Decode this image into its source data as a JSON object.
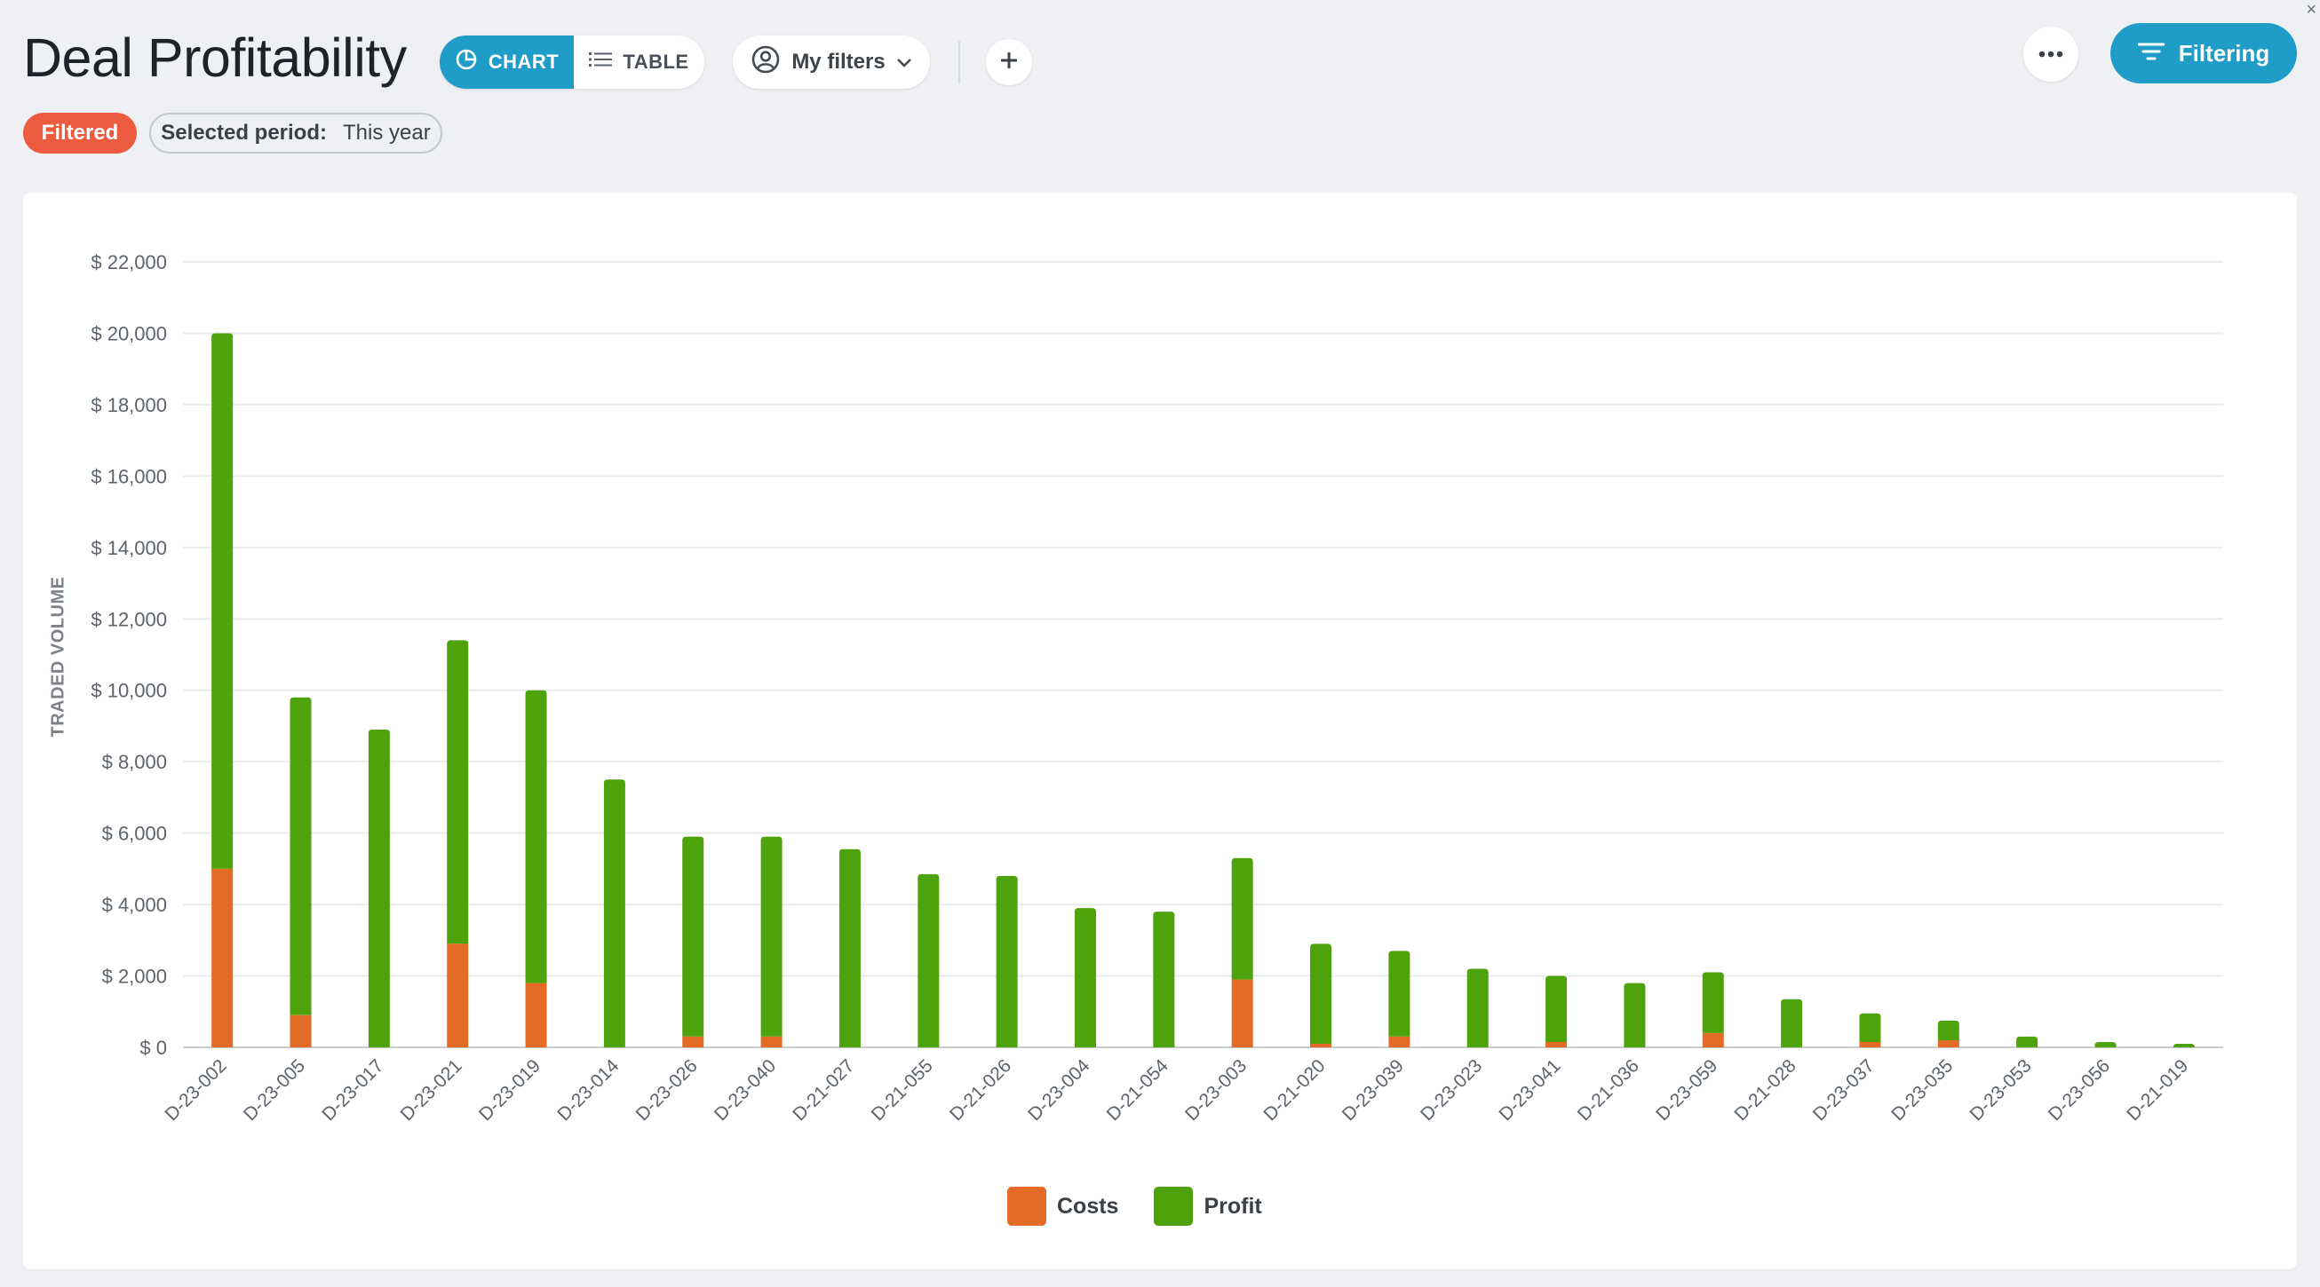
{
  "header": {
    "title": "Deal Profitability",
    "view_toggle": {
      "chart_label": "CHART",
      "table_label": "TABLE",
      "active": "chart"
    },
    "my_filters_label": "My filters",
    "filtering_label": "Filtering",
    "corner_glyph": "×"
  },
  "filters": {
    "badge": "Filtered",
    "period_key": "Selected period:",
    "period_value": "This year"
  },
  "colors": {
    "accent": "#1f9cc8",
    "costs": "#e46b26",
    "profit": "#4ea20c",
    "badge": "#ec5b40"
  },
  "chart_data": {
    "type": "bar",
    "stacked": true,
    "ylabel": "TRADED VOLUME",
    "ylim": [
      0,
      22000
    ],
    "yticks": [
      "$ 0",
      "$ 2,000",
      "$ 4,000",
      "$ 6,000",
      "$ 8,000",
      "$ 10,000",
      "$ 12,000",
      "$ 14,000",
      "$ 16,000",
      "$ 18,000",
      "$ 20,000",
      "$ 22,000"
    ],
    "categories": [
      "D-23-002",
      "D-23-005",
      "D-23-017",
      "D-23-021",
      "D-23-019",
      "D-23-014",
      "D-23-026",
      "D-23-040",
      "D-21-027",
      "D-21-055",
      "D-21-026",
      "D-23-004",
      "D-21-054",
      "D-23-003",
      "D-21-020",
      "D-23-039",
      "D-23-023",
      "D-23-041",
      "D-21-036",
      "D-23-059",
      "D-21-028",
      "D-23-037",
      "D-23-035",
      "D-23-053",
      "D-23-056",
      "D-21-019"
    ],
    "series": [
      {
        "name": "Costs",
        "color": "#e46b26",
        "values": [
          5000,
          900,
          0,
          2900,
          1800,
          0,
          300,
          300,
          0,
          0,
          0,
          0,
          0,
          1900,
          100,
          300,
          0,
          150,
          0,
          400,
          0,
          150,
          200,
          0,
          0,
          0
        ]
      },
      {
        "name": "Profit",
        "color": "#4ea20c",
        "values": [
          15000,
          8900,
          8900,
          8500,
          8200,
          7500,
          5600,
          5600,
          5550,
          4850,
          4800,
          3900,
          3800,
          3400,
          2800,
          2400,
          2200,
          1850,
          1800,
          1700,
          1350,
          800,
          550,
          300,
          150,
          100
        ]
      }
    ],
    "legend_position": "bottom-center",
    "grid": true
  }
}
